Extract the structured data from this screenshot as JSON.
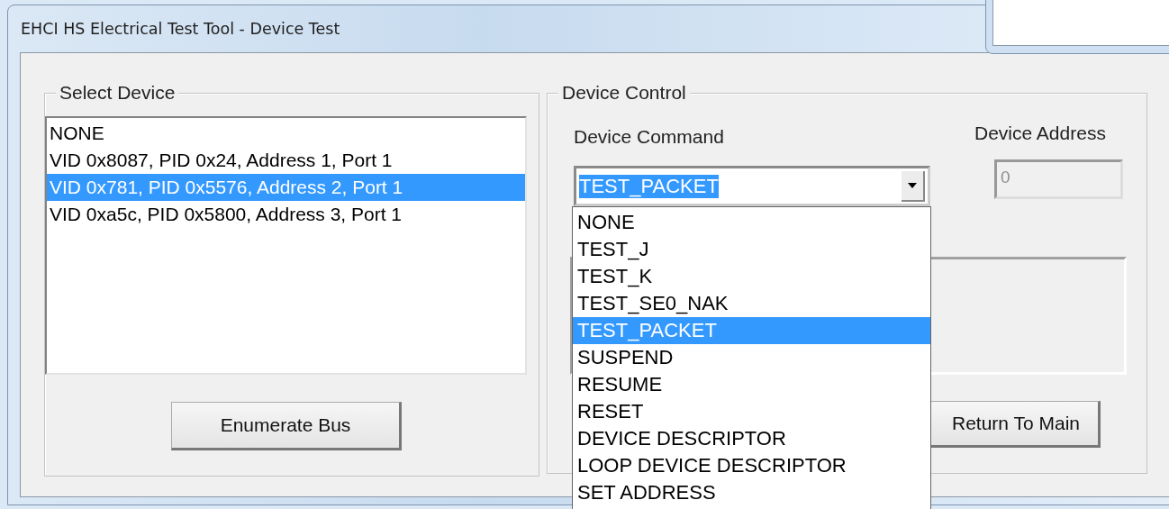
{
  "window": {
    "title": "EHCI HS Electrical Test Tool - Device Test"
  },
  "select_device": {
    "legend": "Select Device",
    "devices": [
      {
        "label": "NONE",
        "selected": false
      },
      {
        "label": "VID 0x8087, PID 0x24, Address 1, Port 1",
        "selected": false
      },
      {
        "label": "VID 0x781, PID 0x5576, Address 2, Port 1",
        "selected": true
      },
      {
        "label": "VID 0xa5c, PID 0x5800, Address 3, Port 1",
        "selected": false
      }
    ],
    "button": "Enumerate Bus"
  },
  "device_control": {
    "legend": "Device Control",
    "command_label": "Device Command",
    "command": {
      "value": "TEST_PACKET",
      "expanded": true,
      "options": [
        {
          "label": "NONE",
          "selected": false
        },
        {
          "label": "TEST_J",
          "selected": false
        },
        {
          "label": "TEST_K",
          "selected": false
        },
        {
          "label": "TEST_SE0_NAK",
          "selected": false
        },
        {
          "label": "TEST_PACKET",
          "selected": true
        },
        {
          "label": "SUSPEND",
          "selected": false
        },
        {
          "label": "RESUME",
          "selected": false
        },
        {
          "label": "RESET",
          "selected": false
        },
        {
          "label": "DEVICE DESCRIPTOR",
          "selected": false
        },
        {
          "label": "LOOP DEVICE DESCRIPTOR",
          "selected": false
        },
        {
          "label": "SET ADDRESS",
          "selected": false
        }
      ]
    },
    "address_label": "Device Address",
    "address": {
      "value": "0",
      "disabled": true
    },
    "button": "Return To Main"
  }
}
